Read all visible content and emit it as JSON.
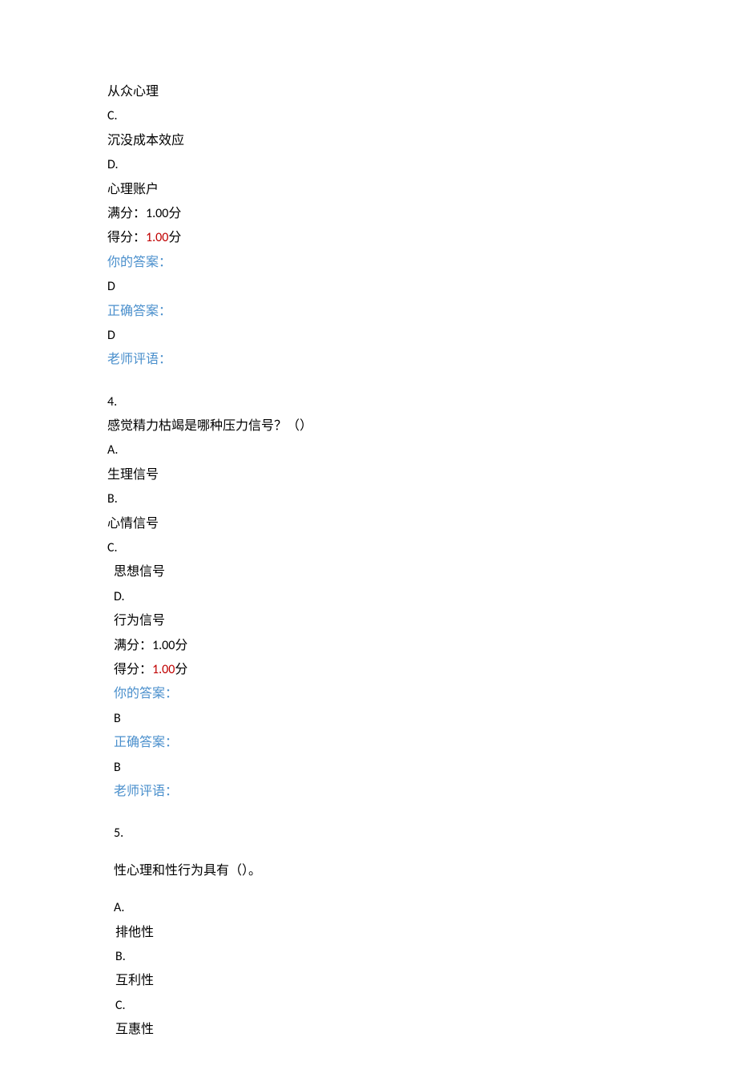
{
  "q3": {
    "optB_text": "从众心理",
    "optC_letter": "C.",
    "optC_text": "沉没成本效应",
    "optD_letter": "D.",
    "optD_text": "心理账户",
    "full_label": "满分：",
    "full_value": "1.00",
    "full_unit": "分",
    "score_label": "得分：",
    "score_value": "1.00",
    "score_unit": "分",
    "your_answer_label": "你的答案：",
    "your_answer": "D",
    "correct_answer_label": "正确答案：",
    "correct_answer": "D",
    "teacher_label": "老师评语："
  },
  "q4": {
    "number": "4.",
    "stem": "感觉精力枯竭是哪种压力信号？（）",
    "optA_letter": "A.",
    "optA_text": "生理信号",
    "optB_letter": "B.",
    "optB_text": "心情信号",
    "optC_letter": "C.",
    "optC_text": "思想信号",
    "optD_letter": "D.",
    "optD_text": "行为信号",
    "full_label": "满分：",
    "full_value": "1.00",
    "full_unit": "分",
    "score_label": "得分：",
    "score_value": "1.00",
    "score_unit": "分",
    "your_answer_label": "你的答案：",
    "your_answer": "B",
    "correct_answer_label": "正确答案：",
    "correct_answer": "B",
    "teacher_label": "老师评语："
  },
  "q5": {
    "number": "5.",
    "stem": "性心理和性行为具有（）。",
    "optA_letter": "A.",
    "optA_text": "排他性",
    "optB_letter": "B.",
    "optB_text": "互利性",
    "optC_letter": "C.",
    "optC_text": "互惠性"
  }
}
